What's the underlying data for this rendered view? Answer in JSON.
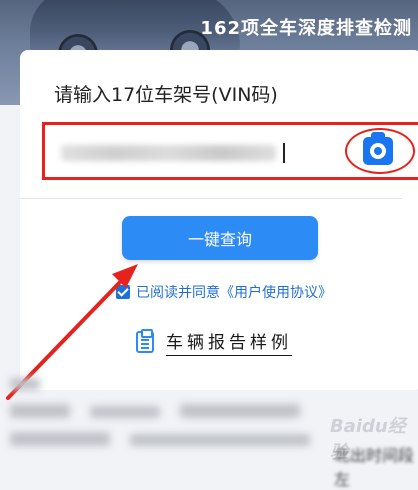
{
  "banner": {
    "line1": "",
    "line2": "162项全车深度排查检测"
  },
  "form": {
    "title": "请输入17位车架号(VIN码)",
    "vin_value": "",
    "camera_icon": "camera-icon",
    "query_button": "一键查询",
    "agree_text": "已阅读并同意《用户使用协议》",
    "sample_link": "车辆报告样例"
  },
  "footer": {
    "tail_text": "北出时间段左",
    "watermark": "Baidu经验"
  },
  "colors": {
    "accent": "#2d8bf5",
    "annotation_red": "#e5231c",
    "link_blue": "#1f6fd8"
  }
}
